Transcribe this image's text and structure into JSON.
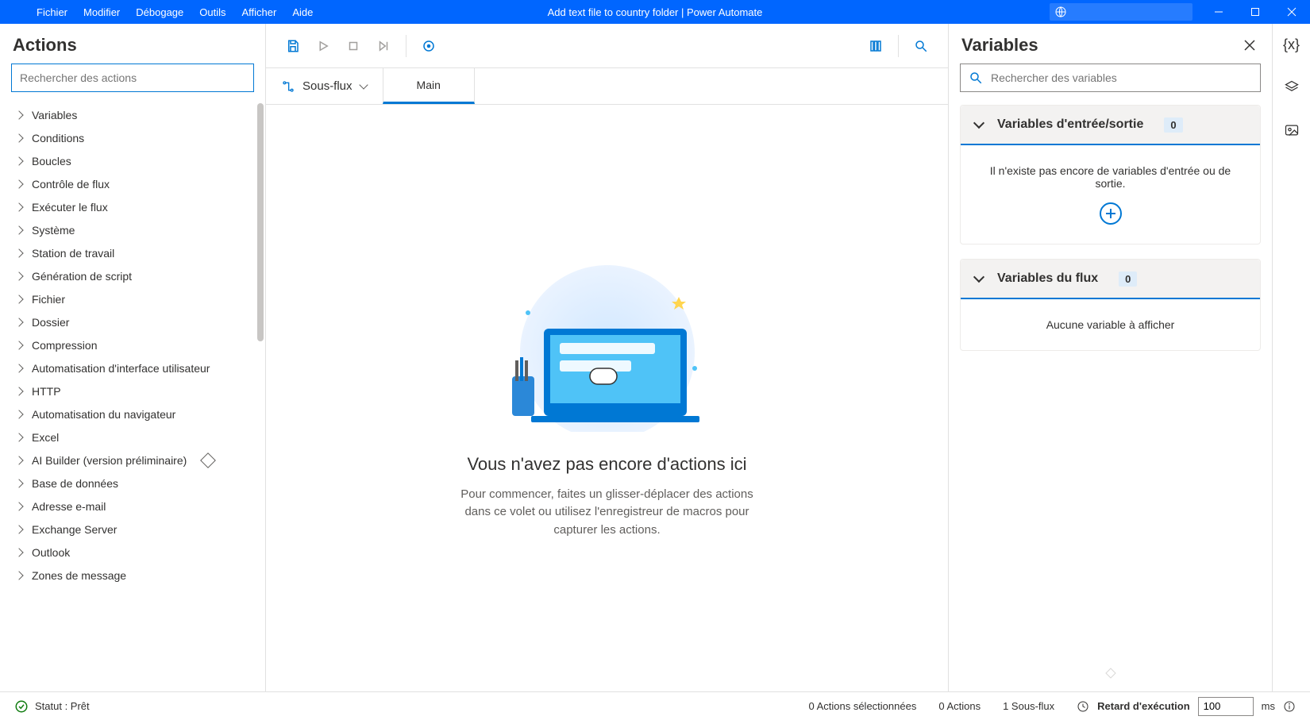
{
  "titlebar": {
    "menus": [
      "Fichier",
      "Modifier",
      "Débogage",
      "Outils",
      "Afficher",
      "Aide"
    ],
    "title": "Add text file to country folder | Power Automate"
  },
  "actions_pane": {
    "title": "Actions",
    "search_placeholder": "Rechercher des actions",
    "categories": [
      {
        "label": "Variables"
      },
      {
        "label": "Conditions"
      },
      {
        "label": "Boucles"
      },
      {
        "label": "Contrôle de flux"
      },
      {
        "label": "Exécuter le flux"
      },
      {
        "label": "Système"
      },
      {
        "label": "Station de travail"
      },
      {
        "label": "Génération de script"
      },
      {
        "label": "Fichier"
      },
      {
        "label": "Dossier"
      },
      {
        "label": "Compression"
      },
      {
        "label": "Automatisation d'interface utilisateur"
      },
      {
        "label": "HTTP"
      },
      {
        "label": "Automatisation du navigateur"
      },
      {
        "label": "Excel"
      },
      {
        "label": "AI Builder (version préliminaire)",
        "preview": true
      },
      {
        "label": "Base de données"
      },
      {
        "label": "Adresse e-mail"
      },
      {
        "label": "Exchange Server"
      },
      {
        "label": "Outlook"
      },
      {
        "label": "Zones de message"
      }
    ]
  },
  "tabs": {
    "subflows_label": "Sous-flux",
    "main_tab": "Main"
  },
  "canvas": {
    "empty_title": "Vous n'avez pas encore d'actions ici",
    "empty_subtitle": "Pour commencer, faites un glisser-déplacer des actions dans ce volet ou utilisez l'enregistreur de macros pour capturer les actions."
  },
  "variables_pane": {
    "title": "Variables",
    "search_placeholder": "Rechercher des variables",
    "io_section": {
      "title": "Variables d'entrée/sortie",
      "count": "0",
      "empty": "Il n'existe pas encore de variables d'entrée ou de sortie."
    },
    "flow_section": {
      "title": "Variables du flux",
      "count": "0",
      "empty": "Aucune variable à afficher"
    }
  },
  "statusbar": {
    "state": "Statut : Prêt",
    "selected": "0 Actions sélectionnées",
    "actions": "0 Actions",
    "subflows": "1 Sous-flux",
    "delay_label": "Retard d'exécution",
    "delay_value": "100",
    "delay_unit": "ms"
  },
  "rail": {
    "vars": "{x}"
  }
}
